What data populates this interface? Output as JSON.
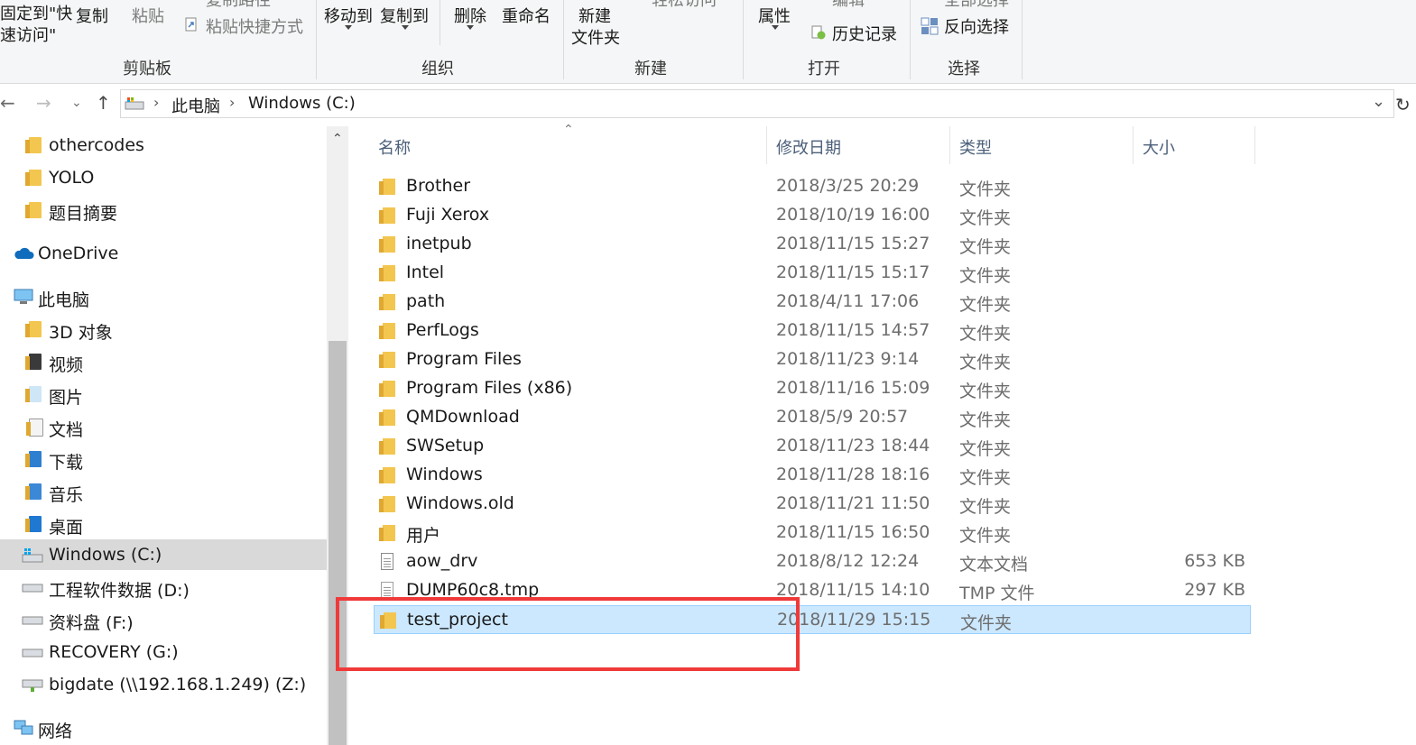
{
  "ribbon": {
    "pin_label": "固定到\"快\n速访问\"",
    "copy": "复制",
    "paste": "粘贴",
    "copy_path_partial": "复制路径",
    "paste_shortcut": "粘贴快捷方式",
    "group_clipboard": "剪贴板",
    "move_to": "移动到",
    "copy_to": "复制到",
    "delete": "删除",
    "rename": "重命名",
    "group_organize": "组织",
    "new_folder_l1": "新建",
    "new_folder_l2": "文件夹",
    "easy_access_partial": "轻松访问",
    "group_new": "新建",
    "properties": "属性",
    "edit_partial": "编辑",
    "history": "历史记录",
    "group_open": "打开",
    "select_all_partial": "全部选择",
    "invert_selection": "反向选择",
    "group_select": "选择"
  },
  "address": {
    "crumbs": [
      "此电脑",
      "Windows (C:)"
    ]
  },
  "nav": {
    "items": [
      {
        "label": "othercodes",
        "icon": "folder-icon"
      },
      {
        "label": "YOLO",
        "icon": "folder-icon"
      },
      {
        "label": "题目摘要",
        "icon": "folder-icon"
      },
      {
        "label": "OneDrive",
        "icon": "cloud-icon"
      },
      {
        "label": "此电脑",
        "icon": "computer-icon"
      },
      {
        "label": "3D 对象",
        "icon": "3d-objects-icon"
      },
      {
        "label": "视频",
        "icon": "video-folder-icon"
      },
      {
        "label": "图片",
        "icon": "pictures-folder-icon"
      },
      {
        "label": "文档",
        "icon": "documents-folder-icon"
      },
      {
        "label": "下载",
        "icon": "downloads-folder-icon"
      },
      {
        "label": "音乐",
        "icon": "music-folder-icon"
      },
      {
        "label": "桌面",
        "icon": "desktop-folder-icon"
      },
      {
        "label": "Windows (C:)",
        "icon": "windows-drive-icon"
      },
      {
        "label": "工程软件数据 (D:)",
        "icon": "drive-icon"
      },
      {
        "label": "资料盘 (F:)",
        "icon": "drive-icon"
      },
      {
        "label": "RECOVERY (G:)",
        "icon": "drive-icon"
      },
      {
        "label": "bigdate (\\\\192.168.1.249) (Z:)",
        "icon": "network-drive-icon"
      },
      {
        "label": "网络",
        "icon": "network-icon"
      }
    ]
  },
  "list": {
    "columns": {
      "name": "名称",
      "date": "修改日期",
      "type": "类型",
      "size": "大小"
    },
    "rows": [
      {
        "name": "Brother",
        "date": "2018/3/25 20:29",
        "type": "文件夹",
        "size": ""
      },
      {
        "name": "Fuji Xerox",
        "date": "2018/10/19 16:00",
        "type": "文件夹",
        "size": ""
      },
      {
        "name": "inetpub",
        "date": "2018/11/15 15:27",
        "type": "文件夹",
        "size": ""
      },
      {
        "name": "Intel",
        "date": "2018/11/15 15:17",
        "type": "文件夹",
        "size": ""
      },
      {
        "name": "path",
        "date": "2018/4/11 17:06",
        "type": "文件夹",
        "size": ""
      },
      {
        "name": "PerfLogs",
        "date": "2018/11/15 14:57",
        "type": "文件夹",
        "size": ""
      },
      {
        "name": "Program Files",
        "date": "2018/11/23 9:14",
        "type": "文件夹",
        "size": ""
      },
      {
        "name": "Program Files (x86)",
        "date": "2018/11/16 15:09",
        "type": "文件夹",
        "size": ""
      },
      {
        "name": "QMDownload",
        "date": "2018/5/9 20:57",
        "type": "文件夹",
        "size": ""
      },
      {
        "name": "SWSetup",
        "date": "2018/11/23 18:44",
        "type": "文件夹",
        "size": ""
      },
      {
        "name": "Windows",
        "date": "2018/11/28 18:16",
        "type": "文件夹",
        "size": ""
      },
      {
        "name": "Windows.old",
        "date": "2018/11/21 11:50",
        "type": "文件夹",
        "size": ""
      },
      {
        "name": "用户",
        "date": "2018/11/15 16:50",
        "type": "文件夹",
        "size": ""
      },
      {
        "name": "aow_drv",
        "date": "2018/8/12 12:24",
        "type": "文本文档",
        "size": "653 KB"
      },
      {
        "name": "DUMP60c8.tmp",
        "date": "2018/11/15 14:10",
        "type": "TMP 文件",
        "size": "297 KB"
      },
      {
        "name": "test_project",
        "date": "2018/11/29 15:15",
        "type": "文件夹",
        "size": ""
      }
    ]
  },
  "colors": {
    "selection": "#cce8ff",
    "highlight_box": "#f03a3a"
  }
}
